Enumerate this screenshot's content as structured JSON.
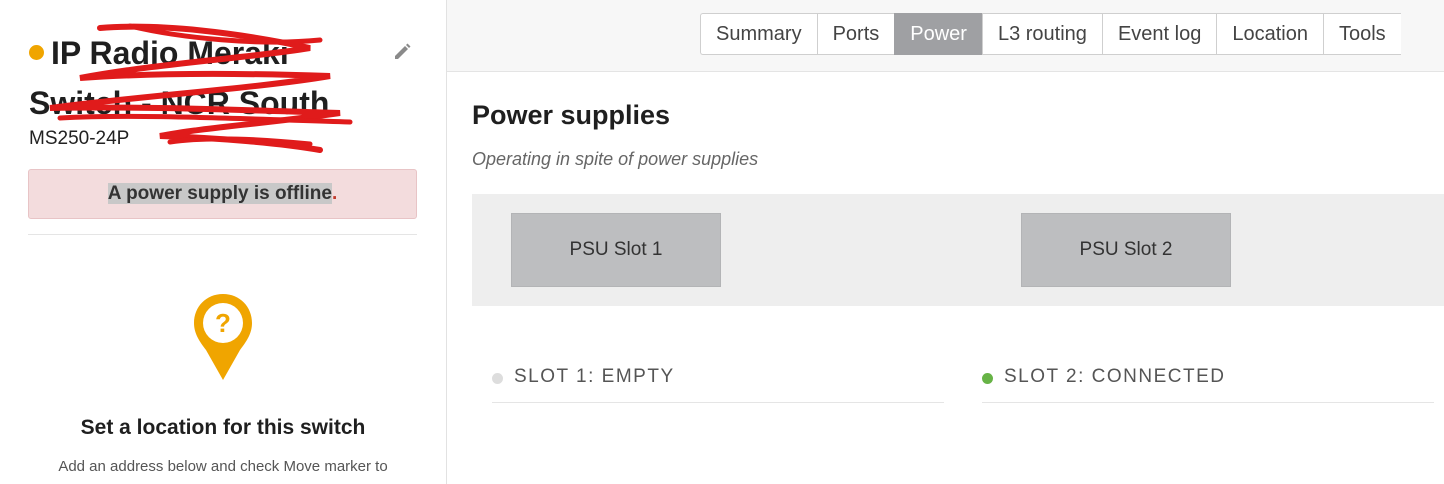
{
  "sidebar": {
    "title_line1": "IP Radio Meraki",
    "title_line2": "Switch - NCR South",
    "model": "MS250-24P",
    "alert": {
      "highlighted": "A power supply is offline",
      "trailing": "."
    },
    "location": {
      "title": "Set a location for this switch",
      "text": "Add an address below and check Move marker to"
    }
  },
  "tabs": [
    "Summary",
    "Ports",
    "Power",
    "L3 routing",
    "Event log",
    "Location",
    "Tools"
  ],
  "active_tab": "Power",
  "main": {
    "title": "Power supplies",
    "subtitle": "Operating in spite of power supplies",
    "psu_slots": [
      "PSU Slot 1",
      "PSU Slot 2"
    ],
    "slot_status": [
      {
        "label": "SLOT 1: EMPTY",
        "color": "#dddddd"
      },
      {
        "label": "SLOT 2: CONNECTED",
        "color": "#67b346"
      }
    ]
  },
  "colors": {
    "status": "#f0a500",
    "pin": "#f0a500",
    "active_tab": "#9fa0a3",
    "scribble": "#e01b1b"
  },
  "icons": {
    "edit": "pencil-icon",
    "pin": "location-pin-icon"
  }
}
